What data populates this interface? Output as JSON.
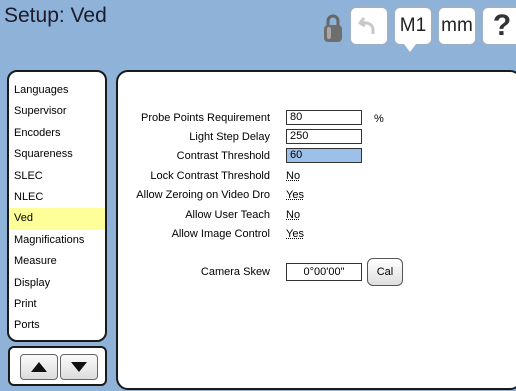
{
  "header": {
    "title": "Setup: Ved",
    "undo_icon": "undo-icon",
    "lock_icon": "lock-icon",
    "m1_label": "M1",
    "units_label": "mm",
    "help_label": "?"
  },
  "sidebar": {
    "items": [
      {
        "label": "Languages"
      },
      {
        "label": "Supervisor"
      },
      {
        "label": "Encoders"
      },
      {
        "label": "Squareness"
      },
      {
        "label": "SLEC"
      },
      {
        "label": "NLEC"
      },
      {
        "label": "Ved",
        "active": true
      },
      {
        "label": "Magnifications"
      },
      {
        "label": "Measure"
      },
      {
        "label": "Display"
      },
      {
        "label": "Print"
      },
      {
        "label": "Ports"
      }
    ],
    "selected_color": "#ffff99"
  },
  "nav": {
    "up_icon": "up-arrow-icon",
    "down_icon": "down-arrow-icon"
  },
  "settings": {
    "probe_points_label": "Probe Points Requirement",
    "probe_points_value": "80",
    "probe_points_unit": "%",
    "light_step_label": "Light Step Delay",
    "light_step_value": "250",
    "contrast_label": "Contrast Threshold",
    "contrast_value": "60",
    "lock_contrast_label": "Lock Contrast Threshold",
    "lock_contrast_value": "No",
    "allow_zeroing_label": "Allow Zeroing on Video Dro",
    "allow_zeroing_value": "Yes",
    "allow_teach_label": "Allow User Teach",
    "allow_teach_value": "No",
    "allow_image_label": "Allow Image Control",
    "allow_image_value": "Yes",
    "camera_skew_label": "Camera Skew",
    "camera_skew_value": "0°00'00\"",
    "cal_label": "Cal"
  },
  "colors": {
    "background": "#8fb2d8",
    "highlight_field": "#9cc0e8"
  }
}
